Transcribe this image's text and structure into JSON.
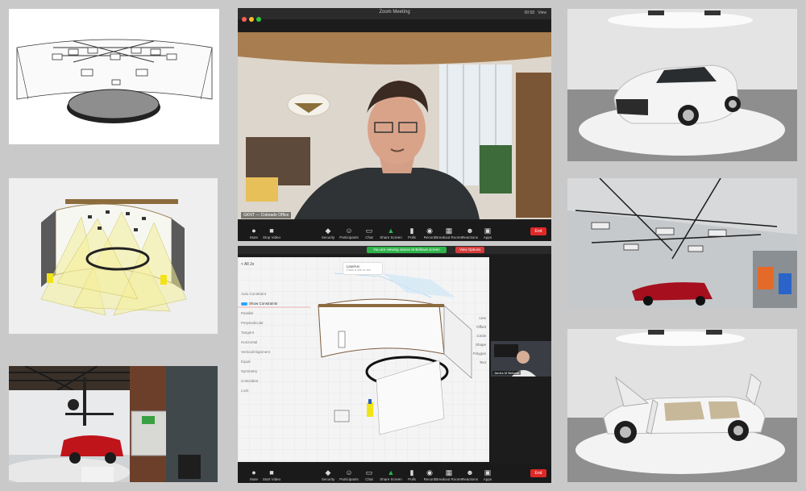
{
  "zoom_meeting": {
    "window_title": "Zoom Meeting",
    "top_right_time": "00:58",
    "top_right_view": "View",
    "participant_name": "GKNT — Colorado Office",
    "toolbar": [
      {
        "icon": "mic-icon",
        "label": "Mute"
      },
      {
        "icon": "video-icon",
        "label": "Stop Video"
      },
      {
        "icon": "shield-icon",
        "label": "Security"
      },
      {
        "icon": "participants-icon",
        "label": "Participants"
      },
      {
        "icon": "chat-icon",
        "label": "Chat"
      },
      {
        "icon": "share-screen-icon",
        "label": "Share Screen"
      },
      {
        "icon": "polls-icon",
        "label": "Polls"
      },
      {
        "icon": "record-icon",
        "label": "Record"
      },
      {
        "icon": "breakout-icon",
        "label": "Breakout Rooms"
      },
      {
        "icon": "reactions-icon",
        "label": "Reactions"
      },
      {
        "icon": "apps-icon",
        "label": "Apps"
      }
    ],
    "end_label": "End",
    "accent_share": "#2fb24a",
    "accent_end": "#e02828"
  },
  "zoom_share": {
    "banner_text": "You are viewing James M Bellows screen",
    "banner_stop": "View Options",
    "top_right": "View",
    "cad": {
      "header": "< All Jo",
      "tooltip_title": "Line/Arc",
      "tooltip_sub": "Draw a line or arc",
      "sidebar": [
        {
          "label": "Auto Constraint",
          "toggle": false
        },
        {
          "label": "Show Constraints",
          "toggle": true
        },
        {
          "label": "Parallel",
          "toggle": false
        },
        {
          "label": "Perpendicular",
          "toggle": false
        },
        {
          "label": "Tangent",
          "toggle": false
        },
        {
          "label": "Horizontal",
          "toggle": false
        },
        {
          "label": "Vertical/Alignment",
          "toggle": false
        },
        {
          "label": "Equal",
          "toggle": false
        },
        {
          "label": "Symmetry",
          "toggle": false
        },
        {
          "label": "Coincident",
          "toggle": false
        },
        {
          "label": "Lock",
          "toggle": false
        }
      ],
      "tools": [
        "Line",
        "Offset",
        "Circle",
        "Shape",
        "Polygon",
        "Text"
      ]
    },
    "selfcam_name": "James M Bellows",
    "toolbar": [
      {
        "icon": "mic-icon",
        "label": "Mute"
      },
      {
        "icon": "video-icon",
        "label": "Start Video"
      },
      {
        "icon": "shield-icon",
        "label": "Security"
      },
      {
        "icon": "participants-icon",
        "label": "Participants"
      },
      {
        "icon": "chat-icon",
        "label": "Chat"
      },
      {
        "icon": "share-screen-icon",
        "label": "Share Screen"
      },
      {
        "icon": "polls-icon",
        "label": "Polls"
      },
      {
        "icon": "record-icon",
        "label": "Record"
      },
      {
        "icon": "breakout-icon",
        "label": "Breakout Rooms"
      },
      {
        "icon": "reactions-icon",
        "label": "Reactions"
      },
      {
        "icon": "apps-icon",
        "label": "Apps"
      }
    ],
    "end_label": "End"
  }
}
